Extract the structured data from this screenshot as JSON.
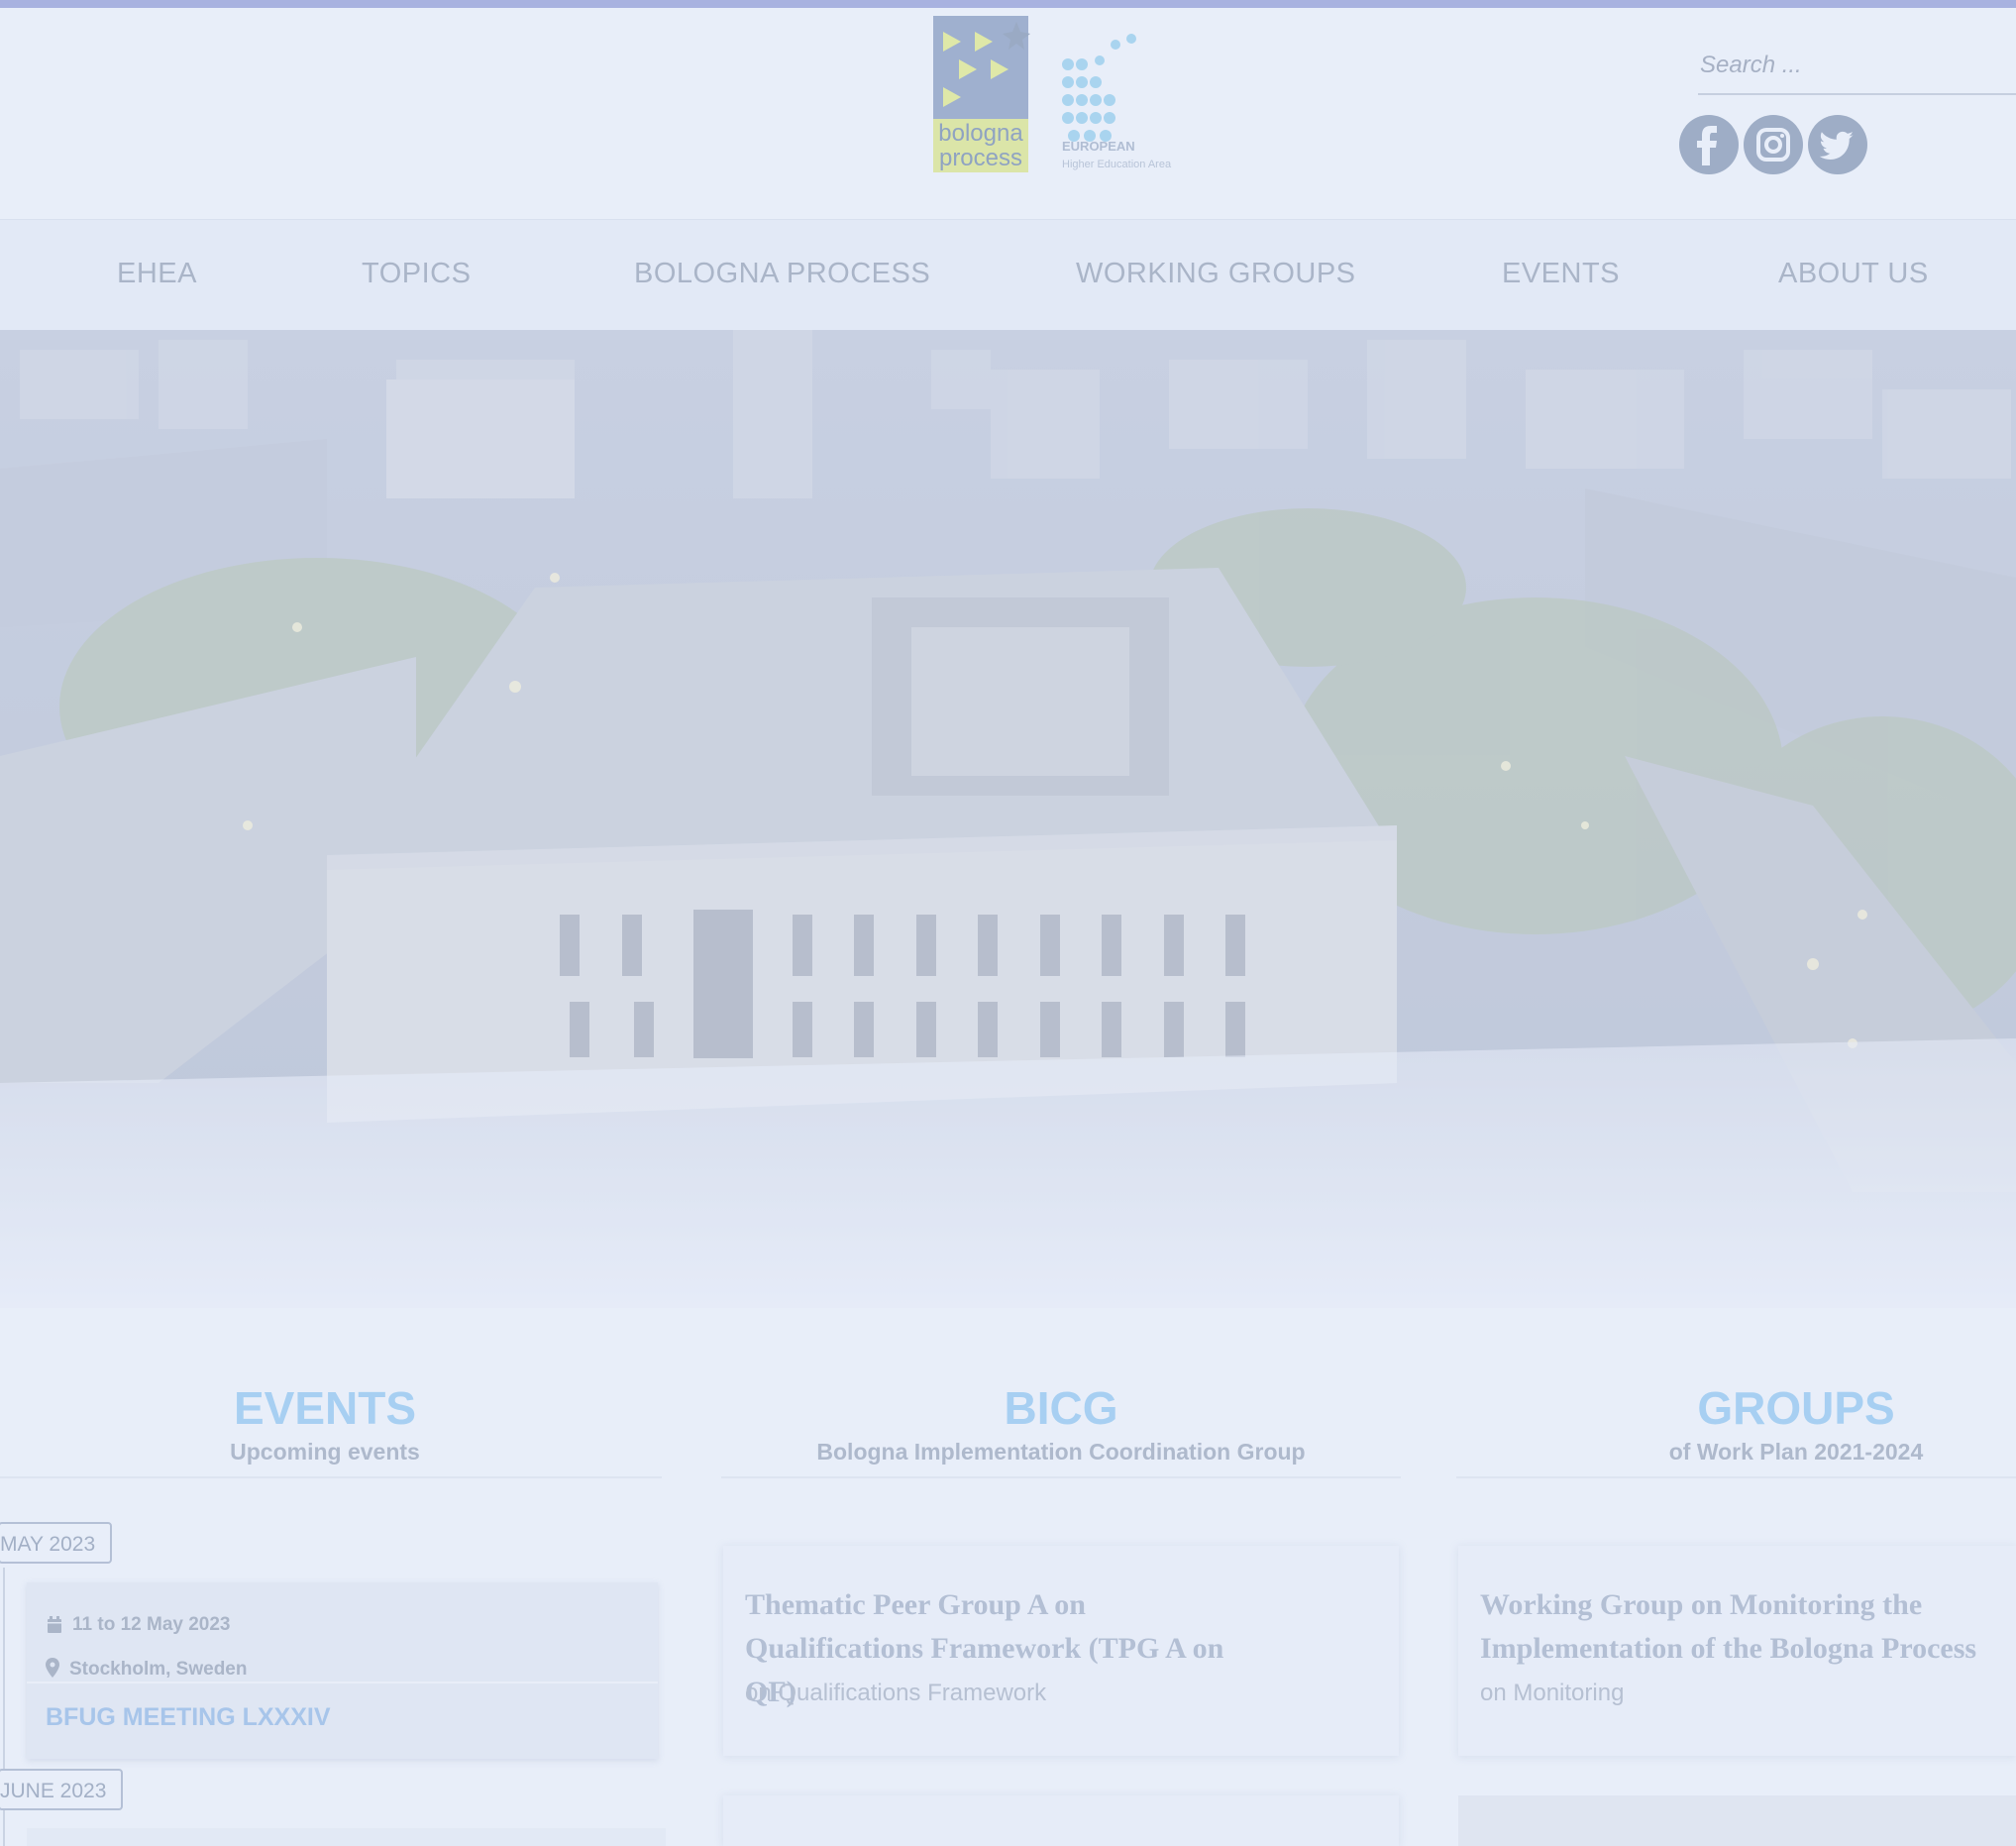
{
  "search": {
    "placeholder": "Search ..."
  },
  "logo": {
    "bologna_text": "bologna\nprocess",
    "ehea_line1": "EUROPEAN",
    "ehea_line2": "Higher Education Area"
  },
  "social": [
    "facebook-icon",
    "instagram-icon",
    "twitter-icon"
  ],
  "nav": {
    "items": [
      {
        "label": "EHEA"
      },
      {
        "label": "TOPICS"
      },
      {
        "label": "BOLOGNA PROCESS"
      },
      {
        "label": "WORKING GROUPS"
      },
      {
        "label": "EVENTS"
      },
      {
        "label": "ABOUT US"
      }
    ]
  },
  "columns": {
    "events": {
      "title": "EVENTS",
      "subtitle": "Upcoming events"
    },
    "bicg": {
      "title": "BICG",
      "subtitle": "Bologna Implementation Coordination Group"
    },
    "groups": {
      "title": "GROUPS",
      "subtitle": "of Work Plan 2021-2024"
    }
  },
  "events": {
    "months": [
      "MAY 2023",
      "JUNE 2023"
    ],
    "items": [
      {
        "date": "11 to 12 May 2023",
        "location": "Stockholm, Sweden",
        "title": "BFUG MEETING LXXXIV"
      }
    ]
  },
  "bicg_cards": [
    {
      "title": "Thematic Peer Group A on Qualifications Framework (TPG A on QF)",
      "subtitle": "on Qualifications Framework"
    }
  ],
  "group_cards": [
    {
      "title": "Working Group on Monitoring the Implementation of the Bologna Process",
      "subtitle": "on Monitoring"
    }
  ],
  "colors": {
    "accent_blue": "#a7cff2",
    "nav_text": "#aab5c8",
    "top_bar": "#a8b2e0"
  }
}
